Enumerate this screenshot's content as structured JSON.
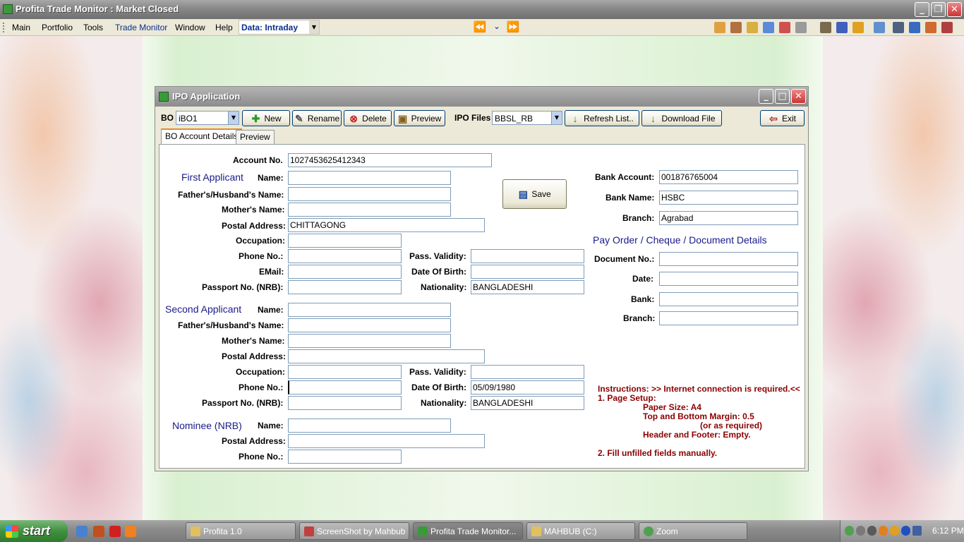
{
  "window": {
    "title": "Profita Trade Monitor : Market Closed"
  },
  "menu": {
    "items": [
      "Main",
      "Portfolio",
      "Tools",
      "Trade Monitor",
      "Window",
      "Help"
    ],
    "data_mode": "Data: Intraday"
  },
  "ipo": {
    "title": "IPO Application",
    "bo_label": "BO",
    "bo_value": "iBO1",
    "new_label": "New",
    "rename_label": "Rename",
    "delete_label": "Delete",
    "preview_label": "Preview",
    "ipo_files_label": "IPO Files",
    "ipo_files_value": "BBSL_RB",
    "refresh_label": "Refresh List..",
    "download_label": "Download File",
    "exit_label": "Exit",
    "tabs": [
      "BO Account Details",
      "Preview"
    ],
    "save_label": "Save"
  },
  "form": {
    "account_no_label": "Account No.",
    "account_no": "1027453625412343",
    "first_applicant": {
      "section": "First Applicant",
      "name_label": "Name:",
      "name": "",
      "father_label": "Father's/Husband's Name:",
      "father": "",
      "mother_label": "Mother's Name:",
      "mother": "",
      "postal_label": "Postal Address:",
      "postal": "CHITTAGONG",
      "occupation_label": "Occupation:",
      "occupation": "",
      "phone_label": "Phone No.:",
      "phone": "",
      "pass_validity_label": "Pass. Validity:",
      "pass_validity": "",
      "email_label": "EMail:",
      "email": "",
      "dob_label": "Date Of Birth:",
      "dob": "",
      "passport_label": "Passport No. (NRB):",
      "passport": "",
      "nationality_label": "Nationality:",
      "nationality": "BANGLADESHI"
    },
    "second_applicant": {
      "section": "Second Applicant",
      "name_label": "Name:",
      "name": "",
      "father_label": "Father's/Husband's Name:",
      "father": "",
      "mother_label": "Mother's Name:",
      "mother": "",
      "postal_label": "Postal Address:",
      "postal": "",
      "occupation_label": "Occupation:",
      "occupation": "",
      "pass_validity_label": "Pass. Validity:",
      "pass_validity": "",
      "phone_label": "Phone No.:",
      "phone": "",
      "dob_label": "Date Of Birth:",
      "dob": "05/09/1980",
      "passport_label": "Passport No. (NRB):",
      "passport": "",
      "nationality_label": "Nationality:",
      "nationality": "BANGLADESHI"
    },
    "nominee": {
      "section": "Nominee (NRB)",
      "name_label": "Name:",
      "name": "",
      "postal_label": "Postal Address:",
      "postal": "",
      "phone_label": "Phone No.:",
      "phone": ""
    },
    "bank": {
      "account_label": "Bank Account:",
      "account": "001876765004",
      "name_label": "Bank Name:",
      "name": "HSBC",
      "branch_label": "Branch:",
      "branch": "Agrabad"
    },
    "pay_order": {
      "section": "Pay Order / Cheque / Document Details",
      "document_label": "Document No.:",
      "document": "",
      "date_label": "Date:",
      "date": "",
      "bank_label": "Bank:",
      "bank": "",
      "branch_label": "Branch:",
      "branch": ""
    },
    "instructions": [
      "Instructions: >> Internet connection is required.<<",
      "1. Page Setup:",
      "Paper Size: A4",
      "Top and Bottom Margin: 0.5",
      "(or as required)",
      "Header and Footer: Empty.",
      "2. Fill unfilled fields manually."
    ]
  },
  "taskbar": {
    "start_label": "start",
    "tasks": [
      "Profita 1.0",
      "ScreenShot by Mahbub",
      "Profita Trade Monitor...",
      "MAHBUB (C:)",
      "Zoom"
    ],
    "clock": "6:12 PM"
  }
}
